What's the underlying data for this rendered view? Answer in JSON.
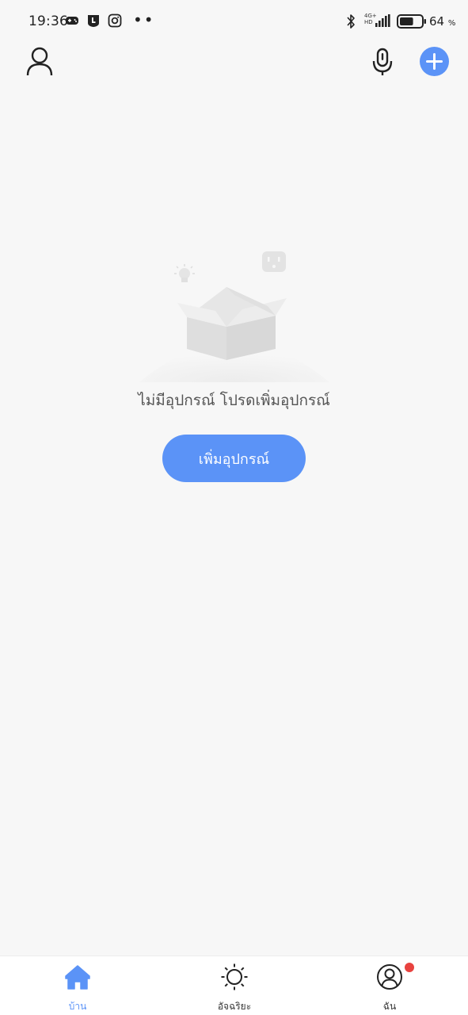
{
  "status_bar": {
    "time": "19:36",
    "network_top": "4G+",
    "network_bottom": "HD",
    "battery_percent": "64",
    "battery_unit": "%",
    "battery_level": 0.64,
    "app_icons": [
      "game-controller-icon",
      "line-icon",
      "instagram-icon"
    ]
  },
  "header": {
    "profile_icon": "person-icon",
    "mic_icon": "microphone-icon",
    "add_icon": "plus-icon"
  },
  "empty_state": {
    "message": "ไม่มีอุปกรณ์ โปรดเพิ่มอุปกรณ์",
    "button_label": "เพิ่มอุปกรณ์",
    "illustration": "empty-box-illustration"
  },
  "bottom_nav": {
    "items": [
      {
        "label": "บ้าน",
        "icon": "home-icon",
        "active": true
      },
      {
        "label": "อัจฉริยะ",
        "icon": "sun-icon",
        "active": false
      },
      {
        "label": "ฉัน",
        "icon": "user-circle-icon",
        "active": false,
        "badge": true
      }
    ]
  },
  "colors": {
    "accent": "#5b93f7",
    "background": "#f7f7f7",
    "badge": "#e8423f"
  }
}
